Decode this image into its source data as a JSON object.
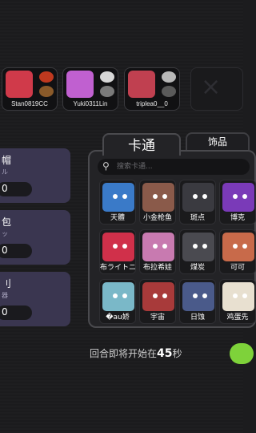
{
  "players": [
    {
      "name": "Stan0819CC",
      "avatar_color": "#d03a4a",
      "acc1": "#c0391f",
      "acc2": "#8a5a2a"
    },
    {
      "name": "Yuki0311Lin",
      "avatar_color": "#c060d0",
      "acc1": "#d7d7d7",
      "acc2": "#7a7a7a"
    },
    {
      "name": "triplea0__0",
      "avatar_color": "#c04050",
      "acc1": "#b8b8b8",
      "acc2": "#5a5a5a"
    }
  ],
  "empty_slot_symbol": "×",
  "left_panels": [
    {
      "title": "帽",
      "sub": "ル",
      "value": "0"
    },
    {
      "title": "包",
      "sub": "ッ",
      "value": "0"
    },
    {
      "title": "刂",
      "sub": "器",
      "value": "0"
    }
  ],
  "tabs": {
    "active": "卡通",
    "other": "饰品"
  },
  "search": {
    "placeholder": "搜索卡通..."
  },
  "characters": [
    {
      "label": "天體",
      "color": "#3a7ac8"
    },
    {
      "label": "小金枪鱼",
      "color": "#8a5a4a"
    },
    {
      "label": "斑点",
      "color": "#3a3a40"
    },
    {
      "label": "博克",
      "color": "#7a3ab8"
    },
    {
      "label": "布ライトニー",
      "color": "#d0304a"
    },
    {
      "label": "布拉希娃",
      "color": "#c87ab0"
    },
    {
      "label": "煤炭",
      "color": "#4a4a50"
    },
    {
      "label": "可可",
      "color": "#c86a4a"
    },
    {
      "label": "�au娇",
      "color": "#7ab8c8"
    },
    {
      "label": "宇宙",
      "color": "#a83a3a"
    },
    {
      "label": "日蚀",
      "color": "#4a5a8a"
    },
    {
      "label": "鸡蛋先",
      "color": "#e8e0d0"
    }
  ],
  "countdown": {
    "prefix": "回合即将开始在",
    "seconds": "45",
    "suffix": "秒"
  },
  "colors": {
    "ready": "#7ed23a",
    "panel_bg": "#3a3650"
  }
}
